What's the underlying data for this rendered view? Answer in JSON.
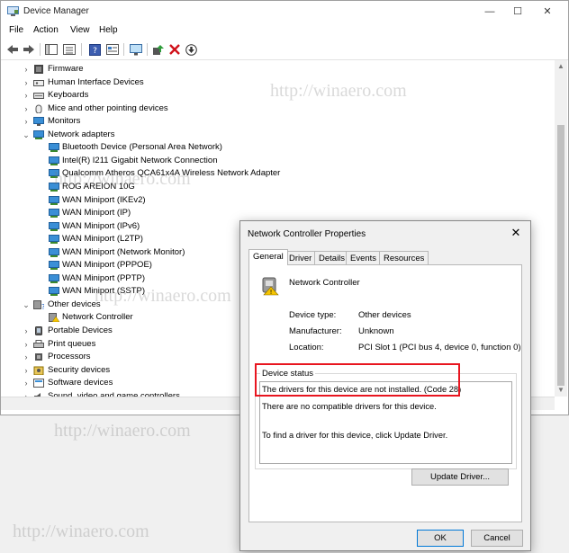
{
  "window": {
    "title": "Device Manager",
    "minimize": "—",
    "maximize": "☐",
    "close": "✕"
  },
  "menu": [
    "File",
    "Action",
    "View",
    "Help"
  ],
  "tree": [
    {
      "label": "Firmware",
      "level": 0,
      "expander": "right",
      "icon": "firmware-icon"
    },
    {
      "label": "Human Interface Devices",
      "level": 0,
      "expander": "right",
      "icon": "hid-icon"
    },
    {
      "label": "Keyboards",
      "level": 0,
      "expander": "right",
      "icon": "keyboard-icon"
    },
    {
      "label": "Mice and other pointing devices",
      "level": 0,
      "expander": "right",
      "icon": "mouse-icon"
    },
    {
      "label": "Monitors",
      "level": 0,
      "expander": "right",
      "icon": "monitor-icon"
    },
    {
      "label": "Network adapters",
      "level": 0,
      "expander": "down",
      "icon": "network-adapter-icon"
    },
    {
      "label": "Bluetooth Device (Personal Area Network)",
      "level": 1,
      "icon": "network-adapter-icon"
    },
    {
      "label": "Intel(R) I211 Gigabit Network Connection",
      "level": 1,
      "icon": "network-adapter-icon"
    },
    {
      "label": "Qualcomm Atheros QCA61x4A Wireless Network Adapter",
      "level": 1,
      "icon": "network-adapter-icon"
    },
    {
      "label": "ROG AREION 10G",
      "level": 1,
      "icon": "network-adapter-icon"
    },
    {
      "label": "WAN Miniport (IKEv2)",
      "level": 1,
      "icon": "network-adapter-icon"
    },
    {
      "label": "WAN Miniport (IP)",
      "level": 1,
      "icon": "network-adapter-icon"
    },
    {
      "label": "WAN Miniport (IPv6)",
      "level": 1,
      "icon": "network-adapter-icon"
    },
    {
      "label": "WAN Miniport (L2TP)",
      "level": 1,
      "icon": "network-adapter-icon"
    },
    {
      "label": "WAN Miniport (Network Monitor)",
      "level": 1,
      "icon": "network-adapter-icon"
    },
    {
      "label": "WAN Miniport (PPPOE)",
      "level": 1,
      "icon": "network-adapter-icon"
    },
    {
      "label": "WAN Miniport (PPTP)",
      "level": 1,
      "icon": "network-adapter-icon"
    },
    {
      "label": "WAN Miniport (SSTP)",
      "level": 1,
      "icon": "network-adapter-icon"
    },
    {
      "label": "Other devices",
      "level": 0,
      "expander": "down",
      "icon": "unknown-device-icon"
    },
    {
      "label": "Network Controller",
      "level": 1,
      "icon": "warning-device-icon"
    },
    {
      "label": "Portable Devices",
      "level": 0,
      "expander": "right",
      "icon": "portable-device-icon"
    },
    {
      "label": "Print queues",
      "level": 0,
      "expander": "right",
      "icon": "printer-icon"
    },
    {
      "label": "Processors",
      "level": 0,
      "expander": "right",
      "icon": "processor-icon"
    },
    {
      "label": "Security devices",
      "level": 0,
      "expander": "right",
      "icon": "security-device-icon"
    },
    {
      "label": "Software devices",
      "level": 0,
      "expander": "right",
      "icon": "software-device-icon"
    },
    {
      "label": "Sound, video and game controllers",
      "level": 0,
      "expander": "right",
      "icon": "sound-icon"
    }
  ],
  "watermark": "http://winaero.com",
  "dialog": {
    "title": "Network Controller Properties",
    "close": "✕",
    "tabs": [
      "General",
      "Driver",
      "Details",
      "Events",
      "Resources"
    ],
    "active_tab": "General",
    "device_name": "Network Controller",
    "props": [
      {
        "label": "Device type:",
        "value": "Other devices"
      },
      {
        "label": "Manufacturer:",
        "value": "Unknown"
      },
      {
        "label": "Location:",
        "value": "PCI Slot 1 (PCI bus 4, device 0, function 0)"
      }
    ],
    "status_caption": "Device status",
    "status_lines": [
      "The drivers for this device are not installed. (Code 28)",
      "There are no compatible drivers for this device.",
      "To find a driver for this device, click Update Driver."
    ],
    "update_driver": "Update Driver...",
    "ok": "OK",
    "cancel": "Cancel"
  },
  "colors": {
    "highlight": "#e8151f",
    "accent": "#0078d7",
    "warning": "#f5c400"
  }
}
